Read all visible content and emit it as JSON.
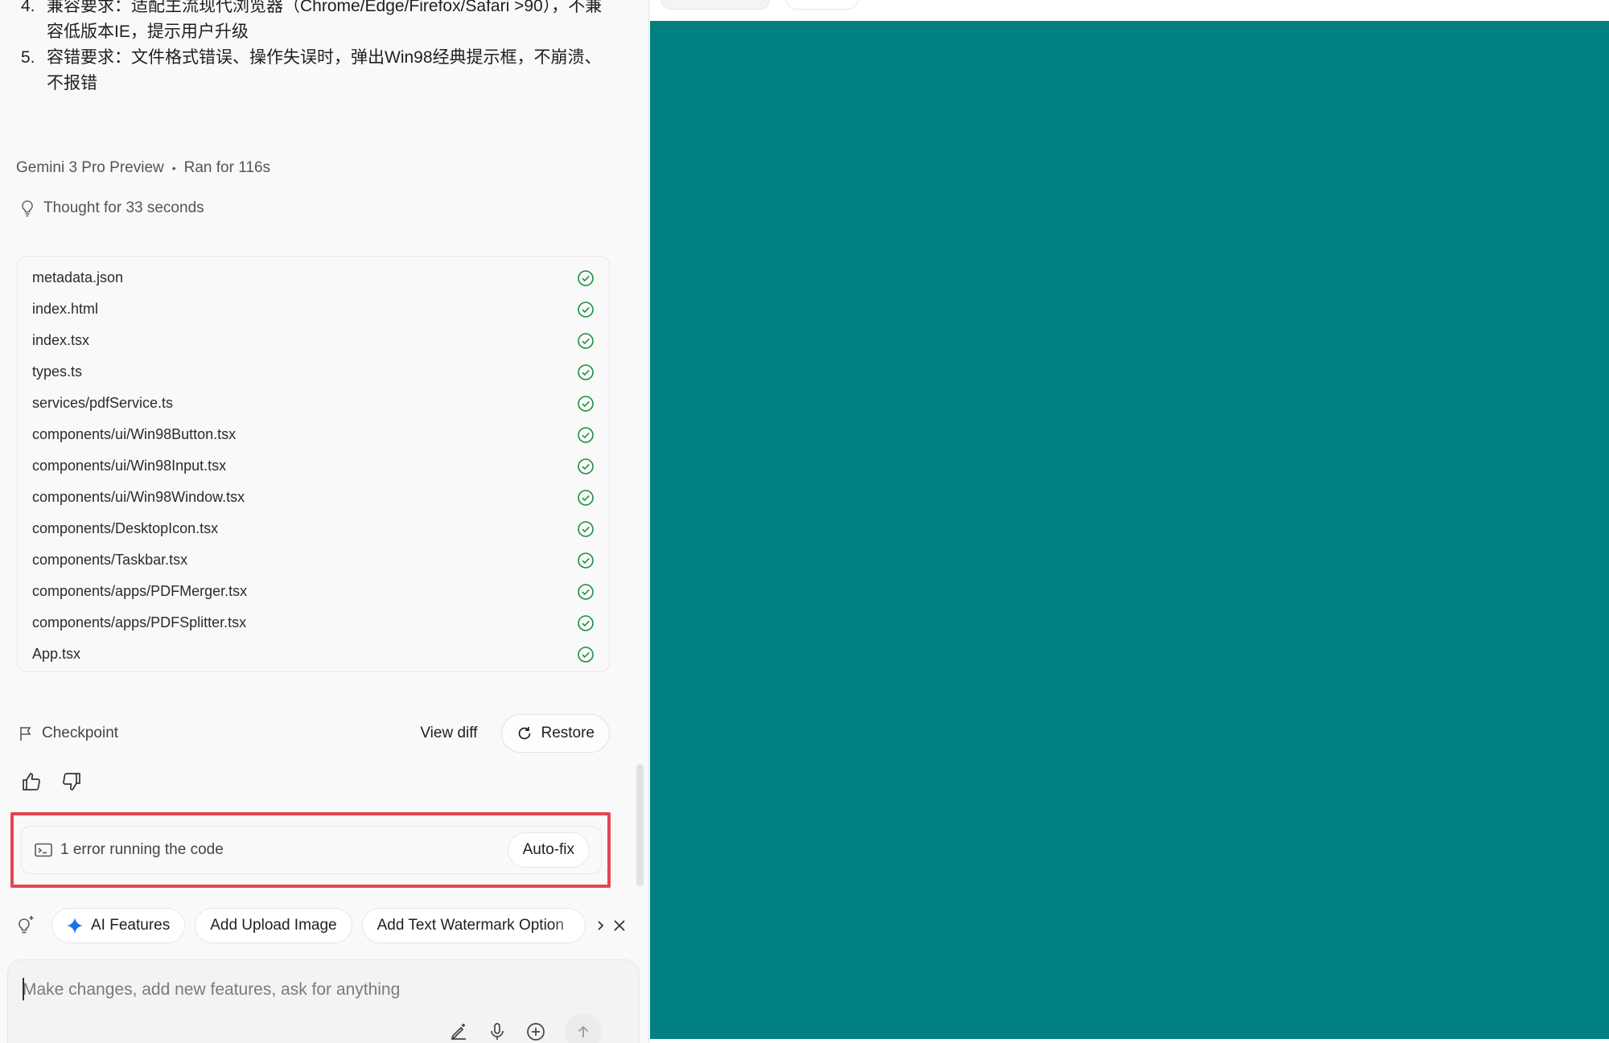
{
  "requirements": [
    {
      "num": "4.",
      "text": "兼容要求：适配主流现代浏览器（Chrome/Edge/Firefox/Safari >90），不兼容低版本IE，提示用户升级"
    },
    {
      "num": "5.",
      "text": "容错要求：文件格式错误、操作失误时，弹出Win98经典提示框，不崩溃、不报错"
    }
  ],
  "run_meta": {
    "model": "Gemini 3 Pro Preview",
    "separator": "•",
    "duration": "Ran for 116s"
  },
  "thought": "Thought for 33 seconds",
  "files": [
    "metadata.json",
    "index.html",
    "index.tsx",
    "types.ts",
    "services/pdfService.ts",
    "components/ui/Win98Button.tsx",
    "components/ui/Win98Input.tsx",
    "components/ui/Win98Window.tsx",
    "components/DesktopIcon.tsx",
    "components/Taskbar.tsx",
    "components/apps/PDFMerger.tsx",
    "components/apps/PDFSplitter.tsx",
    "App.tsx"
  ],
  "checkpoint": {
    "label": "Checkpoint",
    "view_diff": "View diff",
    "restore": "Restore"
  },
  "error": {
    "message": "1 error running the code",
    "action": "Auto-fix",
    "highlight_color": "#e64552"
  },
  "suggestions": {
    "chips": [
      "AI Features",
      "Add Upload Image",
      "Add Text Watermark Option"
    ]
  },
  "prompt": {
    "placeholder": "Make changes, add new features, ask for anything"
  },
  "colors": {
    "preview_background": "#008080",
    "check_green": "#1e8e3e",
    "sparkle_blue": "#1a73e8"
  }
}
